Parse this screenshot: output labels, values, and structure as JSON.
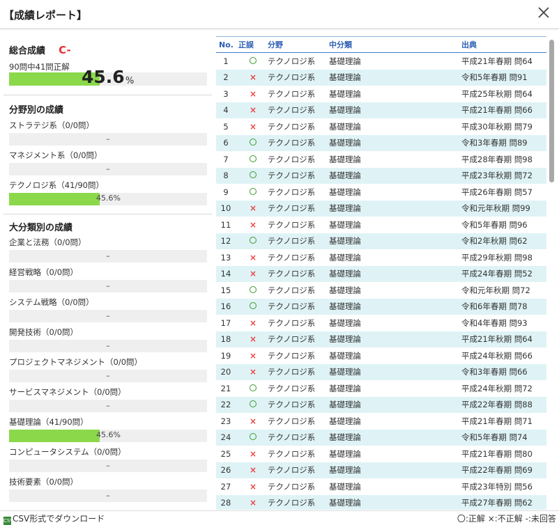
{
  "dialog": {
    "title": "【成績レポート】"
  },
  "overall": {
    "heading": "総合成績",
    "grade": "C-",
    "summary": "90問中41問正解",
    "value": "45.6",
    "unit": "%",
    "fraction": 0.456
  },
  "field_section": {
    "heading": "分野別の成績",
    "items": [
      {
        "label": "ストラテジ系（0/0問）",
        "value": "–",
        "fraction": 0
      },
      {
        "label": "マネジメント系（0/0問）",
        "value": "–",
        "fraction": 0
      },
      {
        "label": "テクノロジ系（41/90問）",
        "value": "45.6%",
        "fraction": 0.456
      }
    ]
  },
  "category_section": {
    "heading": "大分類別の成績",
    "items": [
      {
        "label": "企業と法務（0/0問）",
        "value": "–",
        "fraction": 0
      },
      {
        "label": "経営戦略（0/0問）",
        "value": "–",
        "fraction": 0
      },
      {
        "label": "システム戦略（0/0問）",
        "value": "–",
        "fraction": 0
      },
      {
        "label": "開発技術（0/0問）",
        "value": "–",
        "fraction": 0
      },
      {
        "label": "プロジェクトマネジメント（0/0問）",
        "value": "–",
        "fraction": 0
      },
      {
        "label": "サービスマネジメント（0/0問）",
        "value": "–",
        "fraction": 0
      },
      {
        "label": "基礎理論（41/90問）",
        "value": "45.6%",
        "fraction": 0.456
      },
      {
        "label": "コンピュータシステム（0/0問）",
        "value": "–",
        "fraction": 0
      },
      {
        "label": "技術要素（0/0問）",
        "value": "–",
        "fraction": 0
      }
    ]
  },
  "table": {
    "headers": {
      "no": "No.",
      "result": "正誤",
      "field": "分野",
      "subcategory": "中分類",
      "source": "出典"
    },
    "rows": [
      {
        "no": "1",
        "result": "correct",
        "field": "テクノロジ系",
        "subcategory": "基礎理論",
        "source": "平成21年春期 問64"
      },
      {
        "no": "2",
        "result": "incorrect",
        "field": "テクノロジ系",
        "subcategory": "基礎理論",
        "source": "令和5年春期 問91"
      },
      {
        "no": "3",
        "result": "incorrect",
        "field": "テクノロジ系",
        "subcategory": "基礎理論",
        "source": "平成25年秋期 問64"
      },
      {
        "no": "4",
        "result": "incorrect",
        "field": "テクノロジ系",
        "subcategory": "基礎理論",
        "source": "平成21年春期 問66"
      },
      {
        "no": "5",
        "result": "incorrect",
        "field": "テクノロジ系",
        "subcategory": "基礎理論",
        "source": "平成30年秋期 問79"
      },
      {
        "no": "6",
        "result": "correct",
        "field": "テクノロジ系",
        "subcategory": "基礎理論",
        "source": "令和3年春期 問89"
      },
      {
        "no": "7",
        "result": "correct",
        "field": "テクノロジ系",
        "subcategory": "基礎理論",
        "source": "平成28年春期 問98"
      },
      {
        "no": "8",
        "result": "correct",
        "field": "テクノロジ系",
        "subcategory": "基礎理論",
        "source": "平成23年秋期 問72"
      },
      {
        "no": "9",
        "result": "correct",
        "field": "テクノロジ系",
        "subcategory": "基礎理論",
        "source": "平成26年春期 問57"
      },
      {
        "no": "10",
        "result": "incorrect",
        "field": "テクノロジ系",
        "subcategory": "基礎理論",
        "source": "令和元年秋期 問99"
      },
      {
        "no": "11",
        "result": "incorrect",
        "field": "テクノロジ系",
        "subcategory": "基礎理論",
        "source": "令和5年春期 問96"
      },
      {
        "no": "12",
        "result": "correct",
        "field": "テクノロジ系",
        "subcategory": "基礎理論",
        "source": "令和2年秋期 問62"
      },
      {
        "no": "13",
        "result": "incorrect",
        "field": "テクノロジ系",
        "subcategory": "基礎理論",
        "source": "平成29年秋期 問98"
      },
      {
        "no": "14",
        "result": "incorrect",
        "field": "テクノロジ系",
        "subcategory": "基礎理論",
        "source": "平成24年春期 問52"
      },
      {
        "no": "15",
        "result": "correct",
        "field": "テクノロジ系",
        "subcategory": "基礎理論",
        "source": "令和元年秋期 問72"
      },
      {
        "no": "16",
        "result": "correct",
        "field": "テクノロジ系",
        "subcategory": "基礎理論",
        "source": "令和6年春期 問78"
      },
      {
        "no": "17",
        "result": "incorrect",
        "field": "テクノロジ系",
        "subcategory": "基礎理論",
        "source": "令和4年春期 問93"
      },
      {
        "no": "18",
        "result": "incorrect",
        "field": "テクノロジ系",
        "subcategory": "基礎理論",
        "source": "平成21年秋期 問64"
      },
      {
        "no": "19",
        "result": "incorrect",
        "field": "テクノロジ系",
        "subcategory": "基礎理論",
        "source": "平成24年秋期 問66"
      },
      {
        "no": "20",
        "result": "incorrect",
        "field": "テクノロジ系",
        "subcategory": "基礎理論",
        "source": "令和3年春期 問66"
      },
      {
        "no": "21",
        "result": "correct",
        "field": "テクノロジ系",
        "subcategory": "基礎理論",
        "source": "平成24年秋期 問72"
      },
      {
        "no": "22",
        "result": "correct",
        "field": "テクノロジ系",
        "subcategory": "基礎理論",
        "source": "平成22年春期 問88"
      },
      {
        "no": "23",
        "result": "incorrect",
        "field": "テクノロジ系",
        "subcategory": "基礎理論",
        "source": "平成21年春期 問71"
      },
      {
        "no": "24",
        "result": "correct",
        "field": "テクノロジ系",
        "subcategory": "基礎理論",
        "source": "令和5年春期 問74"
      },
      {
        "no": "25",
        "result": "incorrect",
        "field": "テクノロジ系",
        "subcategory": "基礎理論",
        "source": "平成21年春期 問80"
      },
      {
        "no": "26",
        "result": "incorrect",
        "field": "テクノロジ系",
        "subcategory": "基礎理論",
        "source": "平成22年春期 問69"
      },
      {
        "no": "27",
        "result": "incorrect",
        "field": "テクノロジ系",
        "subcategory": "基礎理論",
        "source": "平成23年特別 問56"
      },
      {
        "no": "28",
        "result": "incorrect",
        "field": "テクノロジ系",
        "subcategory": "基礎理論",
        "source": "平成27年春期 問62"
      }
    ]
  },
  "footer": {
    "csv_icon": "CSV",
    "csv_label": "CSV形式でダウンロード",
    "legend": "〇:正解 ×:不正解 -:未回答"
  },
  "colors": {
    "bar_fill": "#8bd94b",
    "grade": "#e8322f",
    "row_alt": "#dff3f6",
    "header_text": "#2d5fb3"
  },
  "icons": {
    "close": "close-icon",
    "correct": "circle-icon",
    "incorrect": "cross-icon",
    "csv": "csv-file-icon"
  }
}
